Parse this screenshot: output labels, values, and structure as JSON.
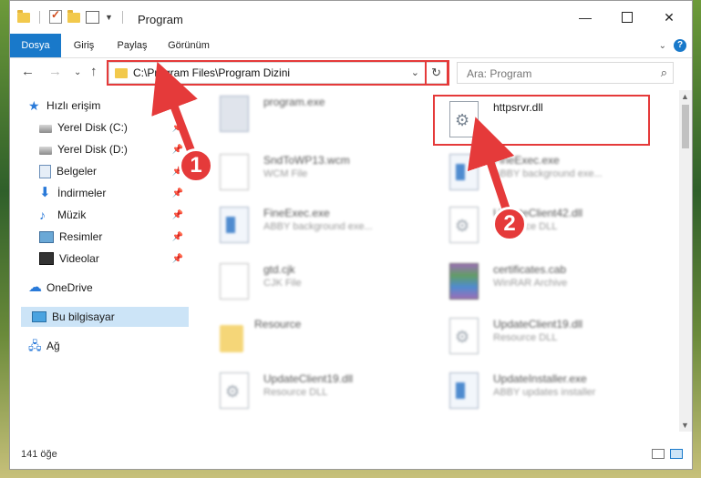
{
  "window": {
    "title": "Program"
  },
  "ribbon": {
    "tabs": [
      "Dosya",
      "Giriş",
      "Paylaş",
      "Görünüm"
    ],
    "help_label": "?"
  },
  "address_bar": {
    "path": "C:\\Program Files\\Program Dizini"
  },
  "search": {
    "placeholder": "Ara: Program"
  },
  "sidebar": {
    "quick_access_label": "Hızlı erişim",
    "items": [
      {
        "label": "Yerel Disk (C:)",
        "icon": "drive-icon",
        "pinned": true
      },
      {
        "label": "Yerel Disk (D:)",
        "icon": "drive-icon",
        "pinned": true
      },
      {
        "label": "Belgeler",
        "icon": "documents-icon",
        "pinned": true
      },
      {
        "label": "İndirmeler",
        "icon": "download-icon",
        "pinned": true
      },
      {
        "label": "Müzik",
        "icon": "music-icon",
        "pinned": true
      },
      {
        "label": "Resimler",
        "icon": "pictures-icon",
        "pinned": true
      },
      {
        "label": "Videolar",
        "icon": "videos-icon",
        "pinned": true
      }
    ],
    "onedrive_label": "OneDrive",
    "this_pc_label": "Bu bilgisayar",
    "network_label": "Ağ"
  },
  "files": [
    {
      "name": "program.exe",
      "type": "",
      "icon": "program-icon"
    },
    {
      "name": "httpsrvr.dll",
      "type": "",
      "icon": "dll-icon"
    },
    {
      "name": "SndToWP13.wcm",
      "type": "WCM File",
      "icon": "document-icon"
    },
    {
      "name": "FineExec.exe",
      "type": "ABBY background exe...",
      "icon": "exe-icon"
    },
    {
      "name": "FineExec.exe",
      "type": "ABBY background exe...",
      "icon": "exe-icon"
    },
    {
      "name": "UpdateClient42.dll",
      "type": "Resource DLL",
      "icon": "dll-icon"
    },
    {
      "name": "gtd.cjk",
      "type": "CJK File",
      "icon": "document-icon"
    },
    {
      "name": "certificates.cab",
      "type": "WinRAR Archive",
      "icon": "archive-icon"
    },
    {
      "name": "Resource",
      "type": "",
      "icon": "folder-icon"
    },
    {
      "name": "UpdateClient19.dll",
      "type": "Resource DLL",
      "icon": "dll-icon"
    },
    {
      "name": "UpdateClient19.dll",
      "type": "Resource DLL",
      "icon": "dll-icon"
    },
    {
      "name": "UpdateInstaller.exe",
      "type": "ABBY updates installer",
      "icon": "exe-icon"
    }
  ],
  "status": {
    "item_count": "141 öğe"
  },
  "annotations": {
    "step1": "1",
    "step2": "2",
    "color": "#e53a3a"
  }
}
